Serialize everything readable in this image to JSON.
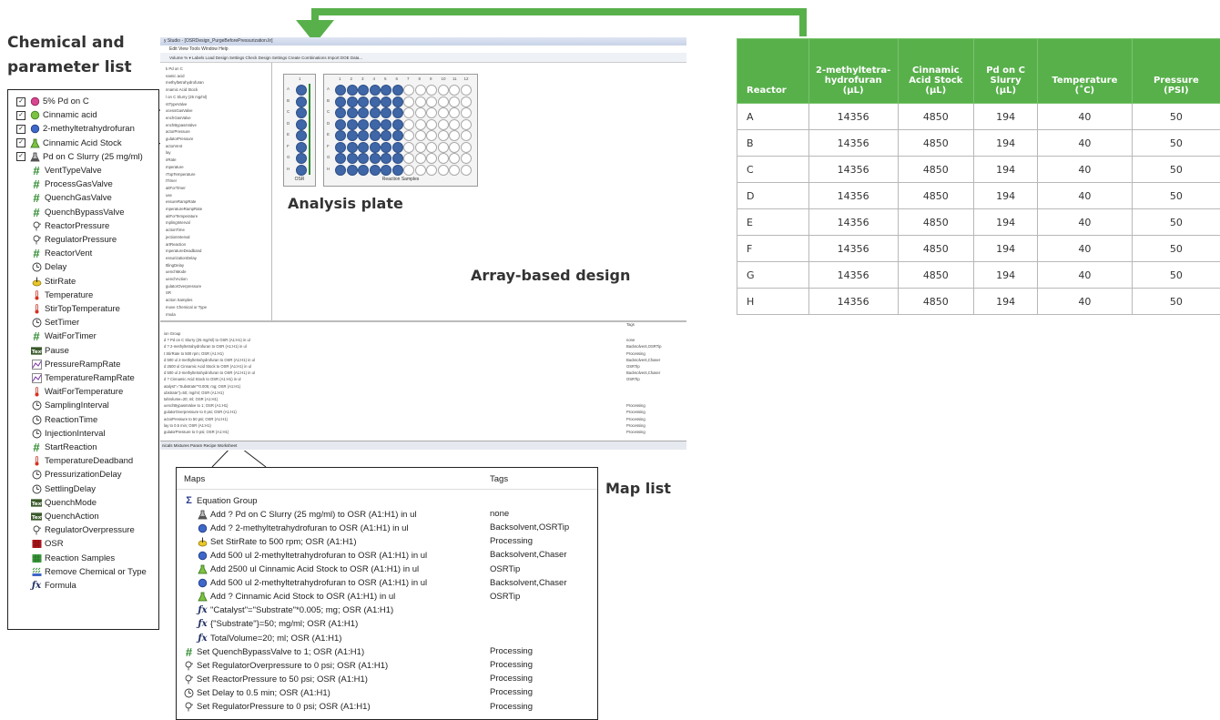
{
  "labels": {
    "chem_list_title_line1": "Chemical and",
    "chem_list_title_line2": "parameter list",
    "analysis_plate": "Analysis plate",
    "array_design": "Array-based design",
    "map_list": "Map list"
  },
  "chem_list": [
    {
      "label": "5% Pd on C",
      "icon": "pink-circle-icon",
      "checked": true
    },
    {
      "label": "Cinnamic acid",
      "icon": "green-circle-icon",
      "checked": true
    },
    {
      "label": "2-methyltetrahydrofuran",
      "icon": "blue-circle-icon",
      "checked": true
    },
    {
      "label": "Cinnamic Acid Stock",
      "icon": "green-flask-icon",
      "checked": true
    },
    {
      "label": "Pd on C Slurry (25 mg/ml)",
      "icon": "flask-icon",
      "checked": true
    },
    {
      "label": "VentTypeValve",
      "icon": "hash-icon"
    },
    {
      "label": "ProcessGasValve",
      "icon": "hash-icon"
    },
    {
      "label": "QuenchGasValve",
      "icon": "hash-icon"
    },
    {
      "label": "QuenchBypassValve",
      "icon": "hash-icon"
    },
    {
      "label": "ReactorPressure",
      "icon": "pressure-icon"
    },
    {
      "label": "RegulatorPressure",
      "icon": "pressure-icon"
    },
    {
      "label": "ReactorVent",
      "icon": "hash-icon"
    },
    {
      "label": "Delay",
      "icon": "clock-icon"
    },
    {
      "label": "StirRate",
      "icon": "stir-icon"
    },
    {
      "label": "Temperature",
      "icon": "thermometer-icon"
    },
    {
      "label": "StirTopTemperature",
      "icon": "thermometer-icon"
    },
    {
      "label": "SetTimer",
      "icon": "clock-icon"
    },
    {
      "label": "WaitForTimer",
      "icon": "hash-icon"
    },
    {
      "label": "Pause",
      "icon": "text-icon"
    },
    {
      "label": "PressureRampRate",
      "icon": "ramp-icon"
    },
    {
      "label": "TemperatureRampRate",
      "icon": "ramp-icon"
    },
    {
      "label": "WaitForTemperature",
      "icon": "thermometer-icon"
    },
    {
      "label": "SamplingInterval",
      "icon": "clock-icon"
    },
    {
      "label": "ReactionTime",
      "icon": "clock-icon"
    },
    {
      "label": "InjectionInterval",
      "icon": "clock-icon"
    },
    {
      "label": "StartReaction",
      "icon": "hash-icon"
    },
    {
      "label": "TemperatureDeadband",
      "icon": "thermometer-icon"
    },
    {
      "label": "PressurizationDelay",
      "icon": "clock-icon"
    },
    {
      "label": "SettlingDelay",
      "icon": "clock-icon"
    },
    {
      "label": "QuenchMode",
      "icon": "text-icon"
    },
    {
      "label": "QuenchAction",
      "icon": "text-icon"
    },
    {
      "label": "RegulatorOverpressure",
      "icon": "pressure-icon"
    },
    {
      "label": "OSR",
      "icon": "red-grid-icon"
    },
    {
      "label": "Reaction Samples",
      "icon": "green-grid-icon"
    },
    {
      "label": "Remove Chemical or Type",
      "icon": "remove-icon"
    },
    {
      "label": "Formula",
      "icon": "fx-icon"
    }
  ],
  "app": {
    "title": "y Studio - [OSRDesign_PurgeBeforePressurization.lir]",
    "menu": "Edit   View   Tools   Window   Help",
    "toolbar": "Volume %  ▾  Labels  Load Design Settings  Check Design Settings  Create Combinations  Import DOE Data...",
    "tree_items": [
      "k Pd on C",
      "namic acid",
      "methyltetrahydrofuran",
      "nnamic Acid Stock",
      "l on C Slurry (25 mg/ml)",
      "ntTypeValve",
      "ocessGasValve",
      "enchGasValve",
      "enchBypassValve",
      "actorPressure",
      "gulatorPressure",
      "actorVent",
      "lay",
      "irRate",
      "mperature",
      "rTopTemperature",
      "tTimer",
      "aitForTimer",
      "use",
      "essureRampRate",
      "mperatureRampRate",
      "aitForTemperature",
      "mplingInterval",
      "actionTime",
      "jectionInterval",
      "artReaction",
      "mperatureDeadband",
      "essurizationDelay",
      "ttlingDelay",
      "uenchMode",
      "uenchAction",
      "gulatorOverpressure",
      "SR",
      "action Samples",
      "move Chemical or Type",
      "rmula"
    ],
    "plate_osr_label": "OSR",
    "plate_rs_label": "Reaction Samples",
    "plate_osr_col": "1",
    "plate_cols": [
      "1",
      "2",
      "3",
      "4",
      "5",
      "6",
      "7",
      "8",
      "9",
      "10",
      "11",
      "12"
    ],
    "plate_rows": [
      "A",
      "B",
      "C",
      "D",
      "E",
      "F",
      "G",
      "H"
    ],
    "bottom_header_tags": "Tags",
    "bottom_rows": [
      {
        "text": "ion Group",
        "tag": ""
      },
      {
        "text": "d ? Pd on C Slurry (25 mg/ml) to OSR (A1:H1) in ul",
        "tag": "none"
      },
      {
        "text": "d ? 2-methyltetrahydrofuran to OSR (A1:H1) in ul",
        "tag": "Backsolvent,OSRTip"
      },
      {
        "text": "t StirRate to 500 rpm; OSR (A1:H1)",
        "tag": "Processing"
      },
      {
        "text": "d 500 ul 2-methyltetrahydrofuran to OSR (A1:H1) in ul",
        "tag": "Backsolvent,Chaser"
      },
      {
        "text": "d 2500 ul Cinnamic Acid Stock to OSR (A1:H1) in ul",
        "tag": "OSRTip"
      },
      {
        "text": "d 500 ul 2-methyltetrahydrofuran to OSR (A1:H1) in ul",
        "tag": "Backsolvent,Chaser"
      },
      {
        "text": "d ? Cinnamic Acid Stock to OSR (A1:H1) in ul",
        "tag": "OSRTip"
      },
      {
        "text": "atalyst\"=\"Substrate\"*0.005; mg; OSR (A1:H1)",
        "tag": ""
      },
      {
        "text": "ubstrate\"}=50; mg/ml; OSR (A1:H1)",
        "tag": ""
      },
      {
        "text": "talVolume=20; ml; OSR (A1:H1)",
        "tag": ""
      },
      {
        "text": "uenchBypassValve to 1; OSR (A1:H1)",
        "tag": "Processing"
      },
      {
        "text": "gulatorOverpressure to 0 psi; OSR (A1:H1)",
        "tag": "Processing"
      },
      {
        "text": "actorPressure to 50 psi; OSR (A1:H1)",
        "tag": "Processing"
      },
      {
        "text": "lay to 0.5 min; OSR (A1:H1)",
        "tag": "Processing"
      },
      {
        "text": "gulatorPressure to 0 psi; OSR (A1:H1)",
        "tag": "Processing"
      }
    ],
    "tabs": "nicals  Mixtures  Param  Recipe  Worksheet"
  },
  "map_list": {
    "header_maps": "Maps",
    "header_tags": "Tags",
    "rows": [
      {
        "text": "Equation Group",
        "tag": "",
        "icon": "sigma-icon",
        "indent": 0
      },
      {
        "text": "Add ? Pd on C Slurry (25 mg/ml) to OSR (A1:H1) in ul",
        "tag": "none",
        "icon": "flask-icon",
        "indent": 1
      },
      {
        "text": "Add ? 2-methyltetrahydrofuran to OSR (A1:H1) in ul",
        "tag": "Backsolvent,OSRTip",
        "icon": "blue-circle-icon",
        "indent": 1
      },
      {
        "text": "Set StirRate to 500 rpm; OSR (A1:H1)",
        "tag": "Processing",
        "icon": "stir-icon",
        "indent": 1
      },
      {
        "text": "Add 500 ul 2-methyltetrahydrofuran to OSR (A1:H1) in ul",
        "tag": "Backsolvent,Chaser",
        "icon": "blue-circle-icon",
        "indent": 1
      },
      {
        "text": "Add 2500 ul Cinnamic Acid Stock to OSR (A1:H1) in ul",
        "tag": "OSRTip",
        "icon": "green-flask-icon",
        "indent": 1
      },
      {
        "text": "Add 500 ul 2-methyltetrahydrofuran to OSR (A1:H1) in ul",
        "tag": "Backsolvent,Chaser",
        "icon": "blue-circle-icon",
        "indent": 1
      },
      {
        "text": "Add ? Cinnamic Acid Stock to OSR (A1:H1) in ul",
        "tag": "OSRTip",
        "icon": "green-flask-icon",
        "indent": 1
      },
      {
        "text": "\"Catalyst\"=\"Substrate\"*0.005; mg; OSR (A1:H1)",
        "tag": "",
        "icon": "fx-icon",
        "indent": 1
      },
      {
        "text": "{\"Substrate\"}=50; mg/ml; OSR (A1:H1)",
        "tag": "",
        "icon": "fx-icon",
        "indent": 1
      },
      {
        "text": "TotalVolume=20; ml; OSR (A1:H1)",
        "tag": "",
        "icon": "fx-icon",
        "indent": 1
      },
      {
        "text": "Set QuenchBypassValve to 1; OSR (A1:H1)",
        "tag": "Processing",
        "icon": "hash-icon",
        "indent": 0
      },
      {
        "text": "Set RegulatorOverpressure to 0 psi; OSR (A1:H1)",
        "tag": "Processing",
        "icon": "pressure-icon",
        "indent": 0
      },
      {
        "text": "Set ReactorPressure to 50 psi; OSR (A1:H1)",
        "tag": "Processing",
        "icon": "pressure-icon",
        "indent": 0
      },
      {
        "text": "Set Delay to 0.5 min; OSR (A1:H1)",
        "tag": "Processing",
        "icon": "clock-icon",
        "indent": 0
      },
      {
        "text": "Set RegulatorPressure to 0 psi; OSR (A1:H1)",
        "tag": "Processing",
        "icon": "pressure-icon",
        "indent": 0
      }
    ]
  },
  "reactor_table": {
    "headers": [
      "Reactor",
      "2-methyltetra-hydrofuran (µL)",
      "Cinnamic Acid Stock (µL)",
      "Pd on C Slurry (µL)",
      "Temperature (˚C)",
      "Pressure (PSI)"
    ],
    "header_lines": [
      [
        "Reactor"
      ],
      [
        "2-methyltetra-",
        "hydrofuran",
        "(µL)"
      ],
      [
        "Cinnamic",
        "Acid Stock",
        "(µL)"
      ],
      [
        "Pd on C",
        "Slurry",
        "(µL)"
      ],
      [
        "Temperature",
        "(˚C)"
      ],
      [
        "Pressure",
        "(PSI)"
      ]
    ],
    "rows": [
      [
        "A",
        "14356",
        "4850",
        "194",
        "40",
        "50"
      ],
      [
        "B",
        "14356",
        "4850",
        "194",
        "40",
        "50"
      ],
      [
        "C",
        "14356",
        "4850",
        "194",
        "40",
        "50"
      ],
      [
        "D",
        "14356",
        "4850",
        "194",
        "40",
        "50"
      ],
      [
        "E",
        "14356",
        "4850",
        "194",
        "40",
        "50"
      ],
      [
        "F",
        "14356",
        "4850",
        "194",
        "40",
        "50"
      ],
      [
        "G",
        "14356",
        "4850",
        "194",
        "40",
        "50"
      ],
      [
        "H",
        "14356",
        "4850",
        "194",
        "40",
        "50"
      ]
    ]
  },
  "colors": {
    "accent_green": "#58b04b",
    "well_filled": "#3f67a8",
    "table_border": "#b8b8b8"
  }
}
